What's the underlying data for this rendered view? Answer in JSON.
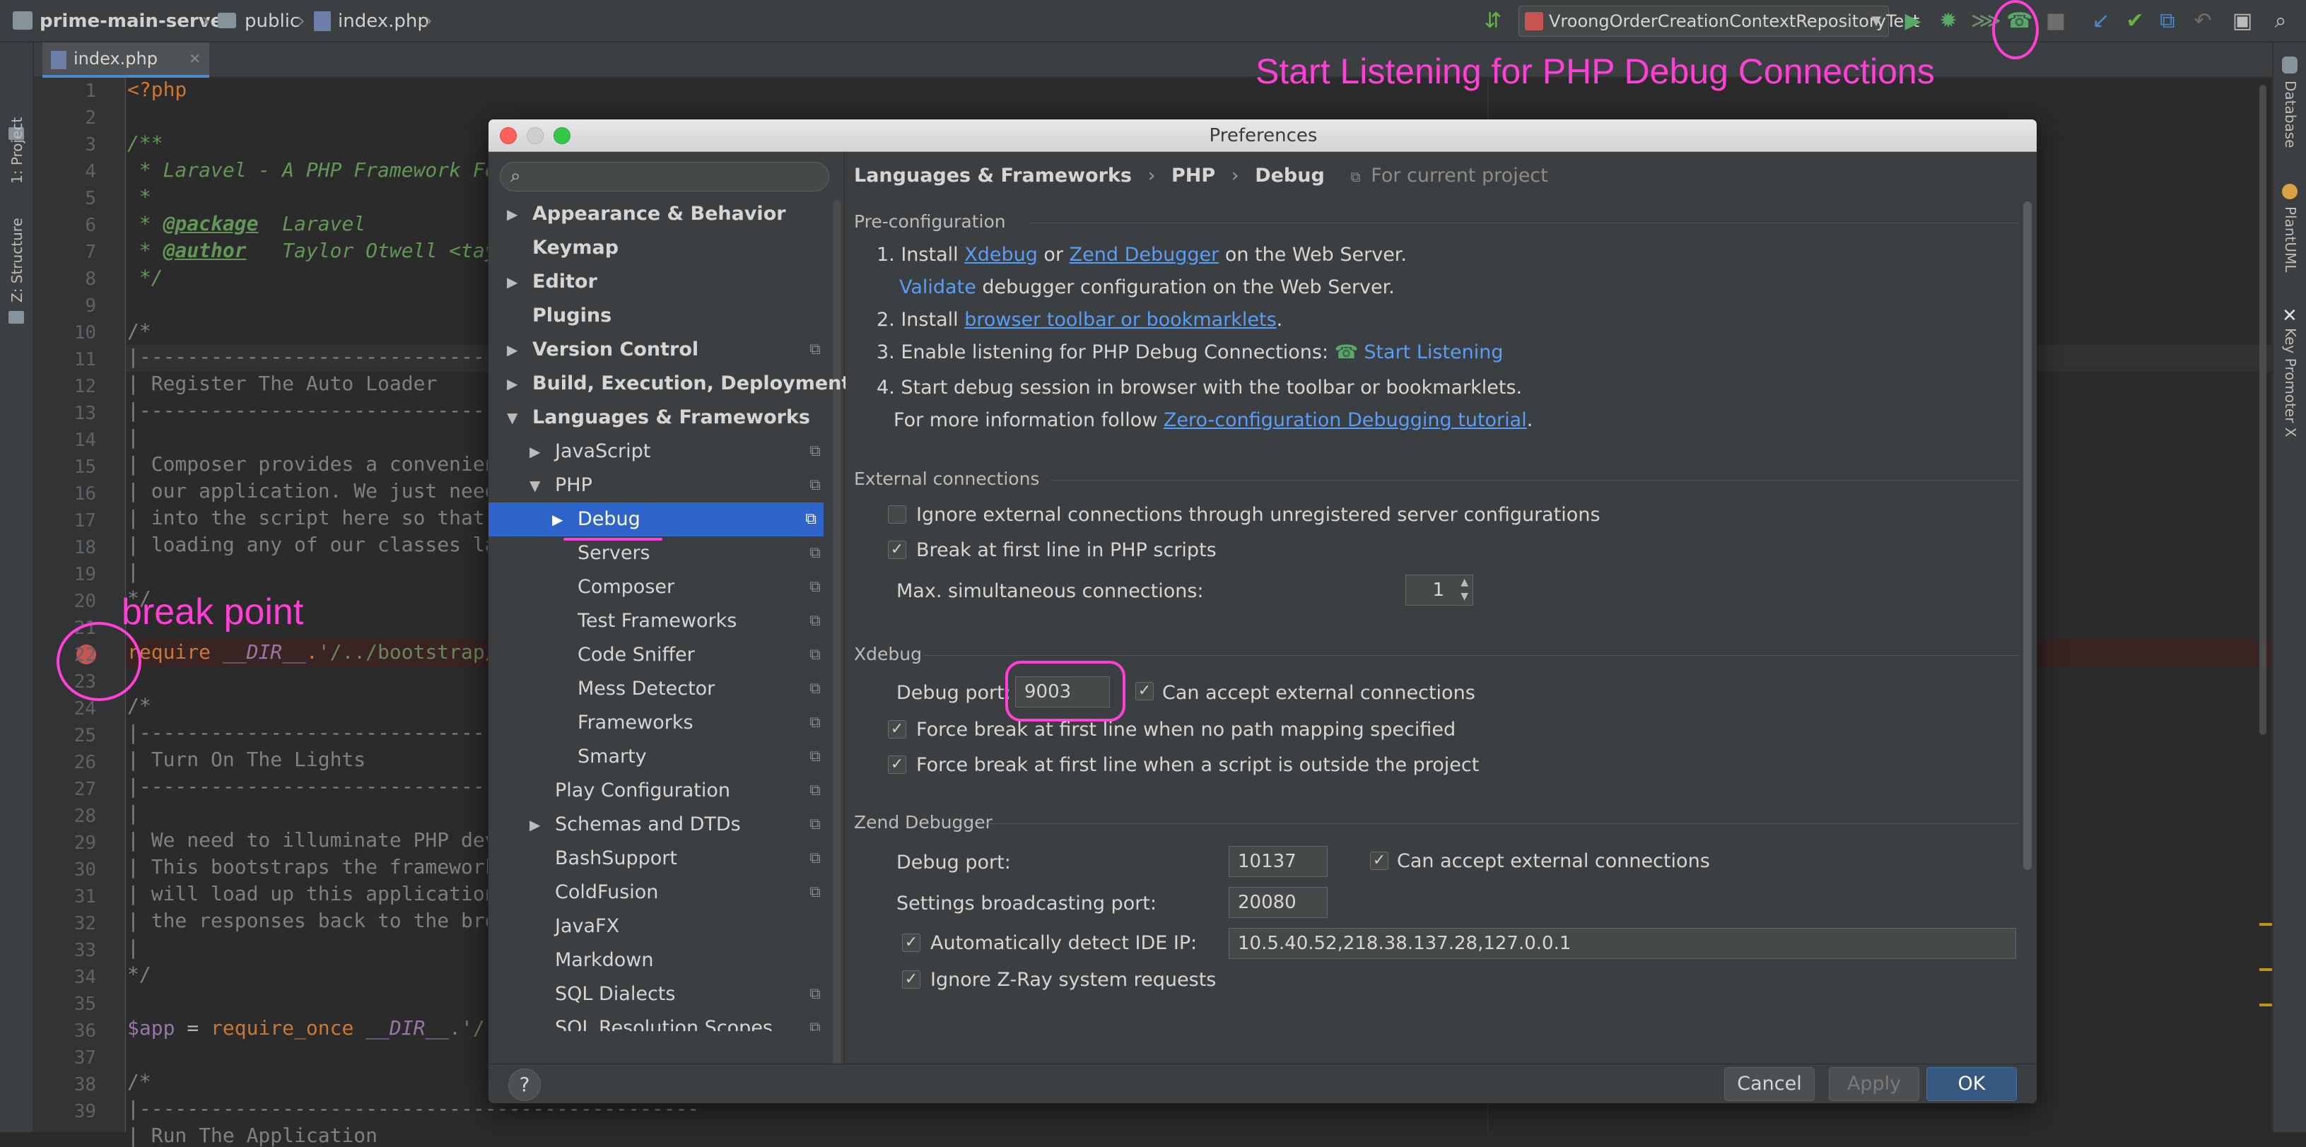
{
  "breadcrumb": {
    "project": "prime-main-server",
    "folder": "public",
    "file": "index.php"
  },
  "toolbar": {
    "run_config": "VroongOrderCreationContextRepositoryTest"
  },
  "editor_tab": {
    "label": "index.php"
  },
  "left_tools": {
    "project": "1: Project",
    "structure": "Z: Structure"
  },
  "right_tools": {
    "database": "Database",
    "plantuml": "PlantUML",
    "key_promoter": "Key Promoter X"
  },
  "editor": {
    "line_numbers": [
      "1",
      "2",
      "3",
      "4",
      "5",
      "6",
      "7",
      "8",
      "9",
      "10",
      "11",
      "12",
      "13",
      "14",
      "15",
      "16",
      "17",
      "18",
      "19",
      "20",
      "21",
      "22",
      "23",
      "24",
      "25",
      "26",
      "27",
      "28",
      "29",
      "30",
      "31",
      "32",
      "33",
      "34",
      "35",
      "36",
      "37",
      "38",
      "39"
    ],
    "lines": {
      "l1": "<?php",
      "l3": "/**",
      "l4": " * Laravel - A PHP Framework For",
      "l5": " *",
      "l6a": " * ",
      "l6b": "@package",
      "l6c": "  Laravel",
      "l7a": " * ",
      "l7b": "@author",
      "l7c": "   Taylor Otwell <tayl",
      "l8": " */",
      "l10": "/*",
      "l11": "|-----------------------------------------------",
      "l12": "| Register The Auto Loader",
      "l13": "|-----------------------------------------------",
      "l14": "|",
      "l15": "| Composer provides a convenient",
      "l16": "| our application. We just need",
      "l17": "| into the script here so that w",
      "l18": "| loading any of our classes lat",
      "l19": "|",
      "l20": "*/",
      "l22a": "require",
      "l22b": " __DIR__",
      "l22c": ".",
      "l22d": "'/../bootstrap/a",
      "l24": "/*",
      "l25": "|-----------------------------------------------",
      "l26": "| Turn On The Lights",
      "l27": "|-----------------------------------------------",
      "l28": "|",
      "l29": "| We need to illuminate PHP deve",
      "l30": "| This bootstraps the framework",
      "l31": "| will load up this application",
      "l32": "| the responses back to the brow",
      "l33": "|",
      "l34": "*/",
      "l36a": "$app",
      "l36b": " = ",
      "l36c": "require_once",
      "l36d": " __DIR__",
      "l36e": ".'/..",
      "l38": "/*",
      "l39": "|-----------------------------------------------",
      "l40": "| Run The Application"
    }
  },
  "annotations": {
    "breakpoint": "break point",
    "listening": "Start Listening for PHP Debug Connections"
  },
  "dialog": {
    "title": "Preferences",
    "search_placeholder": "",
    "nav": {
      "appearance": "Appearance & Behavior",
      "keymap": "Keymap",
      "editor": "Editor",
      "plugins": "Plugins",
      "vcs": "Version Control",
      "build": "Build, Execution, Deployment",
      "languages": "Languages & Frameworks",
      "javascript": "JavaScript",
      "php": "PHP",
      "debug": "Debug",
      "servers": "Servers",
      "composer": "Composer",
      "test_frameworks": "Test Frameworks",
      "code_sniffer": "Code Sniffer",
      "mess_detector": "Mess Detector",
      "frameworks": "Frameworks",
      "smarty": "Smarty",
      "play": "Play Configuration",
      "schemas": "Schemas and DTDs",
      "bash": "BashSupport",
      "coldfusion": "ColdFusion",
      "javafx": "JavaFX",
      "markdown": "Markdown",
      "sql_dialects": "SQL Dialects",
      "sql_resolution": "SQL Resolution Scopes"
    },
    "header": {
      "c1": "Languages & Frameworks",
      "c2": "PHP",
      "c3": "Debug",
      "scope": "For current project"
    },
    "preconfig": {
      "title": "Pre-configuration",
      "s1_a": "1. Install ",
      "s1_xdebug": "Xdebug",
      "s1_or": " or ",
      "s1_zend": "Zend Debugger",
      "s1_b": " on the Web Server.",
      "s1_validate": "Validate",
      "s1_c": " debugger configuration on the Web Server.",
      "s2_a": "2. Install ",
      "s2_link": "browser toolbar or bookmarklets",
      "s2_b": ".",
      "s3_a": "3. Enable listening for PHP Debug Connections: ",
      "s3_link": "Start Listening",
      "s4": "4. Start debug session in browser with the toolbar or bookmarklets.",
      "s4_more": "For more information follow ",
      "s4_link": "Zero-configuration Debugging tutorial",
      "s4_end": "."
    },
    "external": {
      "title": "External connections",
      "ignore": "Ignore external connections through unregistered server configurations",
      "break_first": "Break at first line in PHP scripts",
      "max_label": "Max. simultaneous connections:",
      "max_value": "1"
    },
    "xdebug": {
      "title": "Xdebug",
      "port_label": "Debug port:",
      "port_value": "9003",
      "accept": "Can accept external connections",
      "force_no_mapping": "Force break at first line when no path mapping specified",
      "force_outside": "Force break at first line when a script is outside the project"
    },
    "zend": {
      "title": "Zend Debugger",
      "port_label": "Debug port:",
      "port_value": "10137",
      "accept": "Can accept external connections",
      "broadcast_label": "Settings broadcasting port:",
      "broadcast_value": "20080",
      "auto_detect": "Automatically detect IDE IP:",
      "ip_value": "10.5.40.52,218.38.137.28,127.0.0.1",
      "ignore_zray": "Ignore Z-Ray system requests"
    },
    "footer": {
      "help": "?",
      "cancel": "Cancel",
      "apply": "Apply",
      "ok": "OK"
    }
  },
  "colors": {
    "annotation": "#ff3fd5",
    "link": "#589df6",
    "selection": "#2f65ca"
  }
}
